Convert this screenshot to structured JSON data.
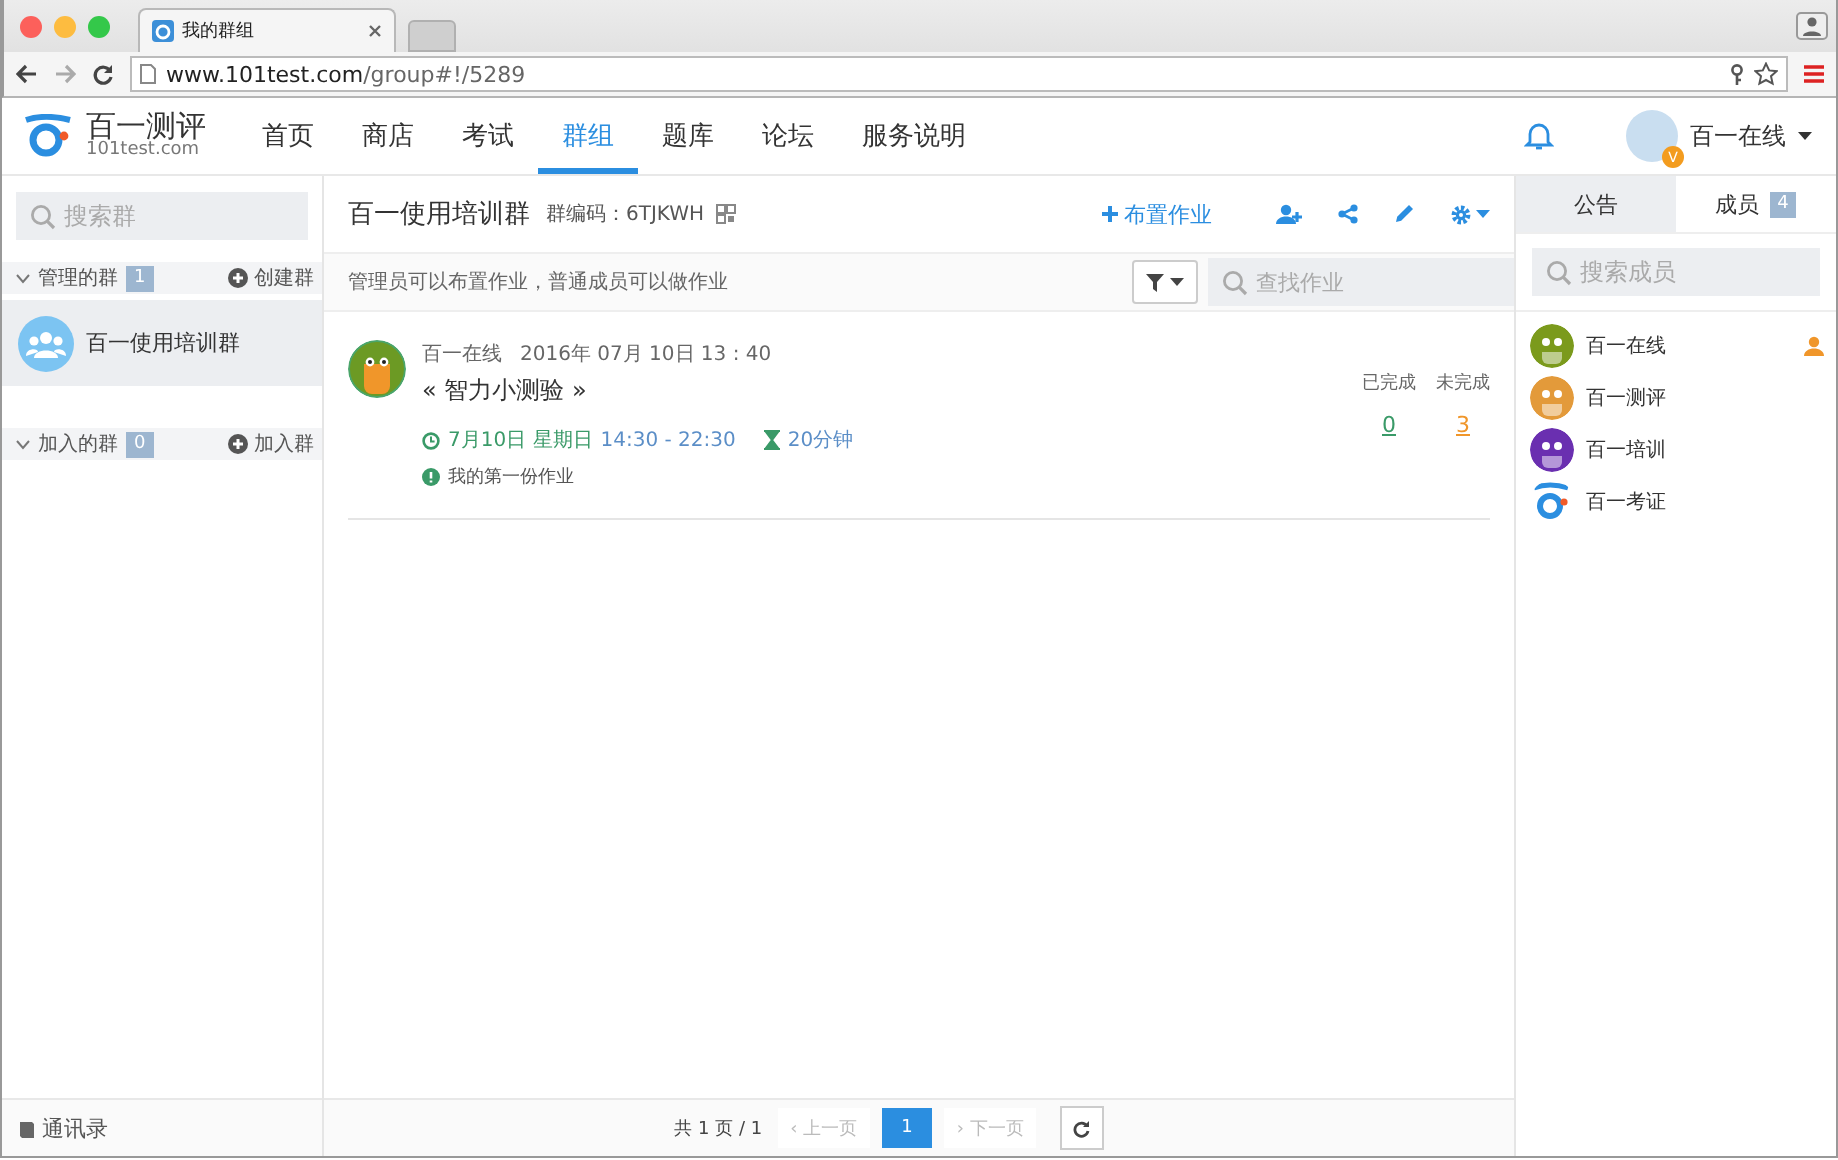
{
  "browser": {
    "tab_title": "我的群组",
    "url_host": "www.101test.com",
    "url_path": "/group#!/5289"
  },
  "header": {
    "logo_name": "百一测评",
    "logo_domain": "101test.com",
    "user_name": "百一在线",
    "user_badge": "V",
    "nav": [
      {
        "label": "首页",
        "selected": false
      },
      {
        "label": "商店",
        "selected": false
      },
      {
        "label": "考试",
        "selected": false
      },
      {
        "label": "群组",
        "selected": true
      },
      {
        "label": "题库",
        "selected": false
      },
      {
        "label": "论坛",
        "selected": false
      },
      {
        "label": "服务说明",
        "selected": false
      }
    ]
  },
  "sidebar": {
    "search_placeholder": "搜索群",
    "footer_link": "通讯录",
    "sections": [
      {
        "title": "管理的群",
        "count": "1",
        "action": "创建群",
        "expanded": true,
        "groups": [
          {
            "name": "百一使用培训群",
            "selected": true
          }
        ]
      },
      {
        "title": "加入的群",
        "count": "0",
        "action": "加入群",
        "expanded": true
      }
    ]
  },
  "group": {
    "name": "百一使用培训群",
    "code_label": "群编码：",
    "code": "6TJKWH",
    "assign_button": "布置作业",
    "notice": "管理员可以布置作业，普通成员可以做作业",
    "search_placeholder": "查找作业"
  },
  "assignments": [
    {
      "author": "百一在线",
      "time": "2016年 07月 10日 13 : 40",
      "title": "« 智力小测验 »",
      "date": "7月10日 星期日",
      "hours": "14:30 - 22:30",
      "duration": "20分钟",
      "note": "我的第一份作业",
      "done_label": "已完成",
      "done": "0",
      "todo_label": "未完成",
      "todo": "3"
    }
  ],
  "members_panel": {
    "search_placeholder": "搜索成员",
    "tabs": [
      {
        "label": "公告",
        "selected": false
      },
      {
        "label": "成员",
        "count": "4",
        "selected": true
      }
    ],
    "members": [
      {
        "name": "百一在线",
        "kind": "avatar",
        "color": "#7b9a1c",
        "admin": true
      },
      {
        "name": "百一测评",
        "kind": "avatar",
        "color": "#e39a3a",
        "admin": false
      },
      {
        "name": "百一培训",
        "kind": "avatar",
        "color": "#6a2fb0",
        "admin": false
      },
      {
        "name": "百一考证",
        "kind": "logo",
        "admin": false
      }
    ]
  },
  "pager": {
    "summary": "共 1 页 / 1",
    "prev": {
      "label": "‹ 上一页",
      "disabled": true
    },
    "next": {
      "label": "› 下一页",
      "disabled": true
    },
    "pages": [
      {
        "label": "1",
        "selected": true
      }
    ]
  }
}
